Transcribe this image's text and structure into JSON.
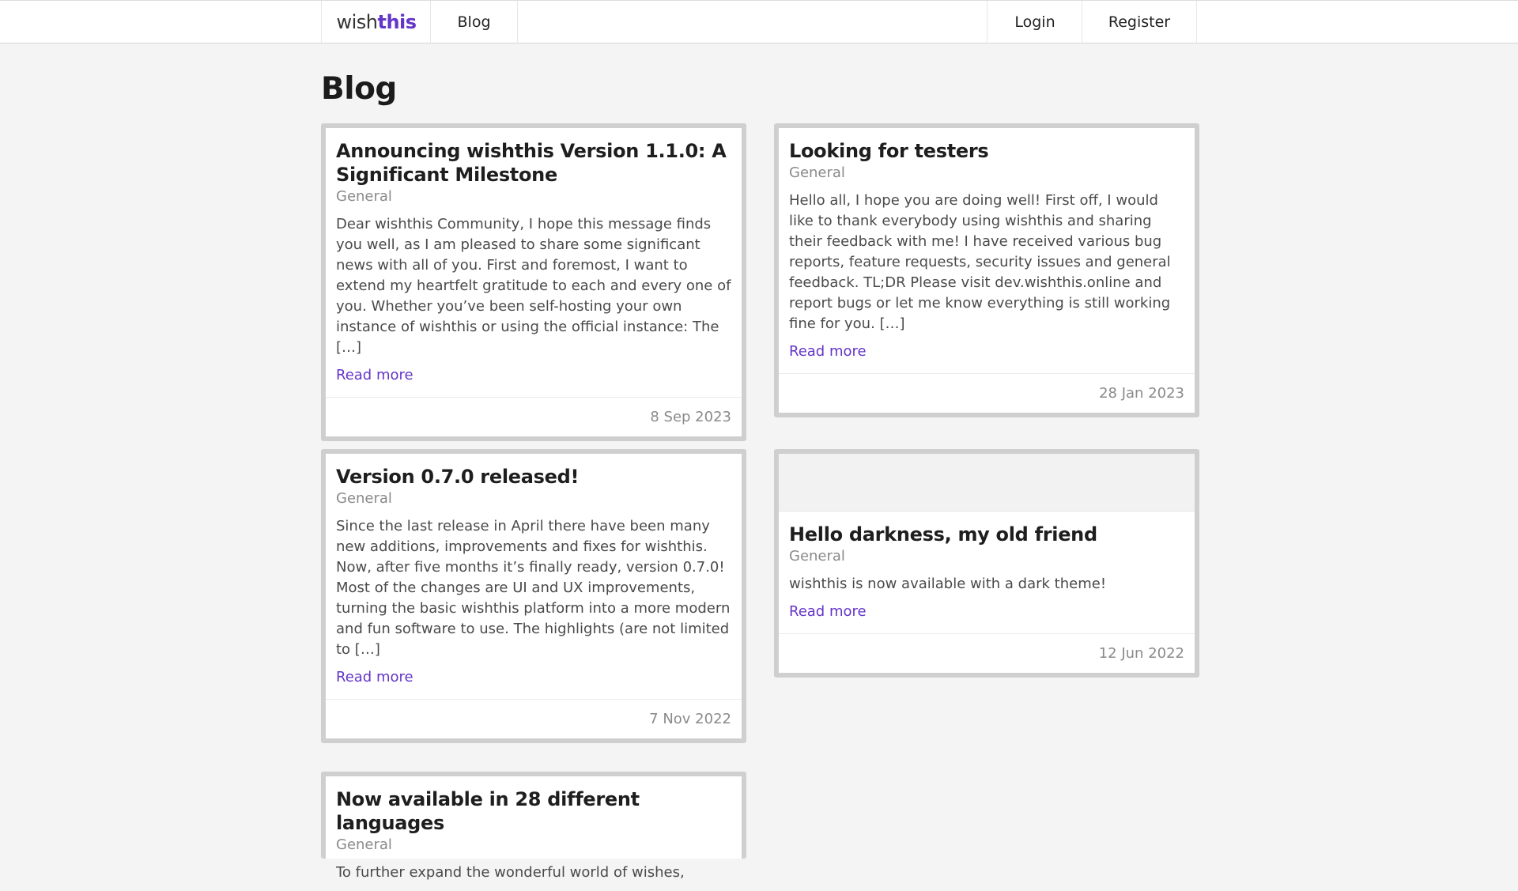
{
  "header": {
    "logo_part1": "wish",
    "logo_part2": "this",
    "nav_blog": "Blog",
    "nav_login": "Login",
    "nav_register": "Register"
  },
  "page": {
    "title": "Blog"
  },
  "posts": [
    {
      "title": "Announcing wishthis Version 1.1.0: A Significant Milestone",
      "category": "General",
      "excerpt": "Dear wishthis Community, I hope this message finds you well, as I am pleased to share some significant news with all of you. First and foremost, I want to extend my heartfelt gratitude to each and every one of you. Whether you’ve been self-hosting your own instance of wishthis or using the official instance: The […]",
      "read_more": "Read more",
      "date": "8 Sep 2023"
    },
    {
      "title": "Looking for testers",
      "category": "General",
      "excerpt": "Hello all, I hope you are doing well! First off, I would like to thank everybody using wishthis and sharing their feedback with me! I have received various bug reports, feature requests, security issues and general feedback. TL;DR Please visit dev.wishthis.online and report bugs or let me know everything is still working fine for you. […]",
      "read_more": "Read more",
      "date": "28 Jan 2023"
    },
    {
      "title": "Version 0.7.0 released!",
      "category": "General",
      "excerpt": "Since the last release in April there have been many new additions, improvements and fixes for wishthis. Now, after five months it’s finally ready, version 0.7.0! Most of the changes are UI and UX improvements, turning the basic wishthis platform into a more modern and fun software to use. The highlights (are not limited to […]",
      "read_more": "Read more",
      "date": "7 Nov 2022"
    },
    {
      "title": "Hello darkness, my old friend",
      "category": "General",
      "excerpt": "wishthis is now available with a dark theme!",
      "read_more": "Read more",
      "date": "12 Jun 2022"
    },
    {
      "title": "Now available in 28 different languages",
      "category": "General",
      "excerpt": "To further expand the wonderful world of wishes,",
      "read_more": "",
      "date": ""
    }
  ]
}
